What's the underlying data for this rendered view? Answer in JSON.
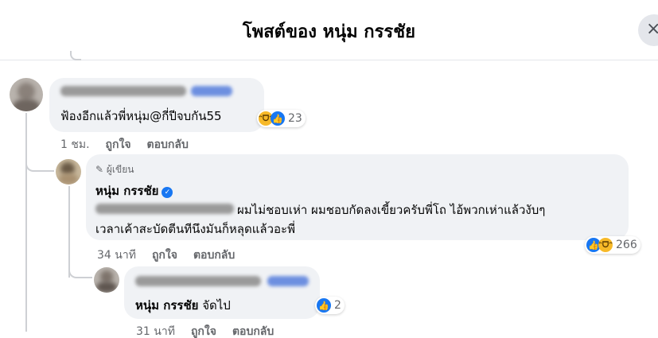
{
  "header": {
    "title": "โพสต์ของ หนุ่ม กรรชัย",
    "close_icon": "×"
  },
  "comments": [
    {
      "text": "ฟ้องอีกแล้วพี่หนุ่ม@กี่ปีจบกัน55",
      "reaction_count": "23",
      "time": "1 ชม.",
      "like_label": "ถูกใจ",
      "reply_label": "ตอบกลับ"
    },
    {
      "author_badge": "ผู้เขียน",
      "author_name": "หนุ่ม กรรชัย",
      "text_line1": "ผมไม่ชอบเห่า ผมชอบกัดลงเขี้ยวครับพี่โถ ไอ้พวกเห่าแล้วงับๆ",
      "text_line2": "เวลาเค้าสะบัดตีนทีนึงมันก็หลุดแล้วอะพี่",
      "reaction_count": "266",
      "time": "34 นาที",
      "like_label": "ถูกใจ",
      "reply_label": "ตอบกลับ"
    },
    {
      "mention": "หนุ่ม กรรชัย",
      "text": "จัดไป",
      "reaction_count": "2",
      "time": "31 นาที",
      "like_label": "ถูกใจ",
      "reply_label": "ตอบกลับ"
    }
  ],
  "colors": {
    "like": "#1877f2",
    "bubble": "#f0f2f5",
    "meta": "#65676b"
  }
}
